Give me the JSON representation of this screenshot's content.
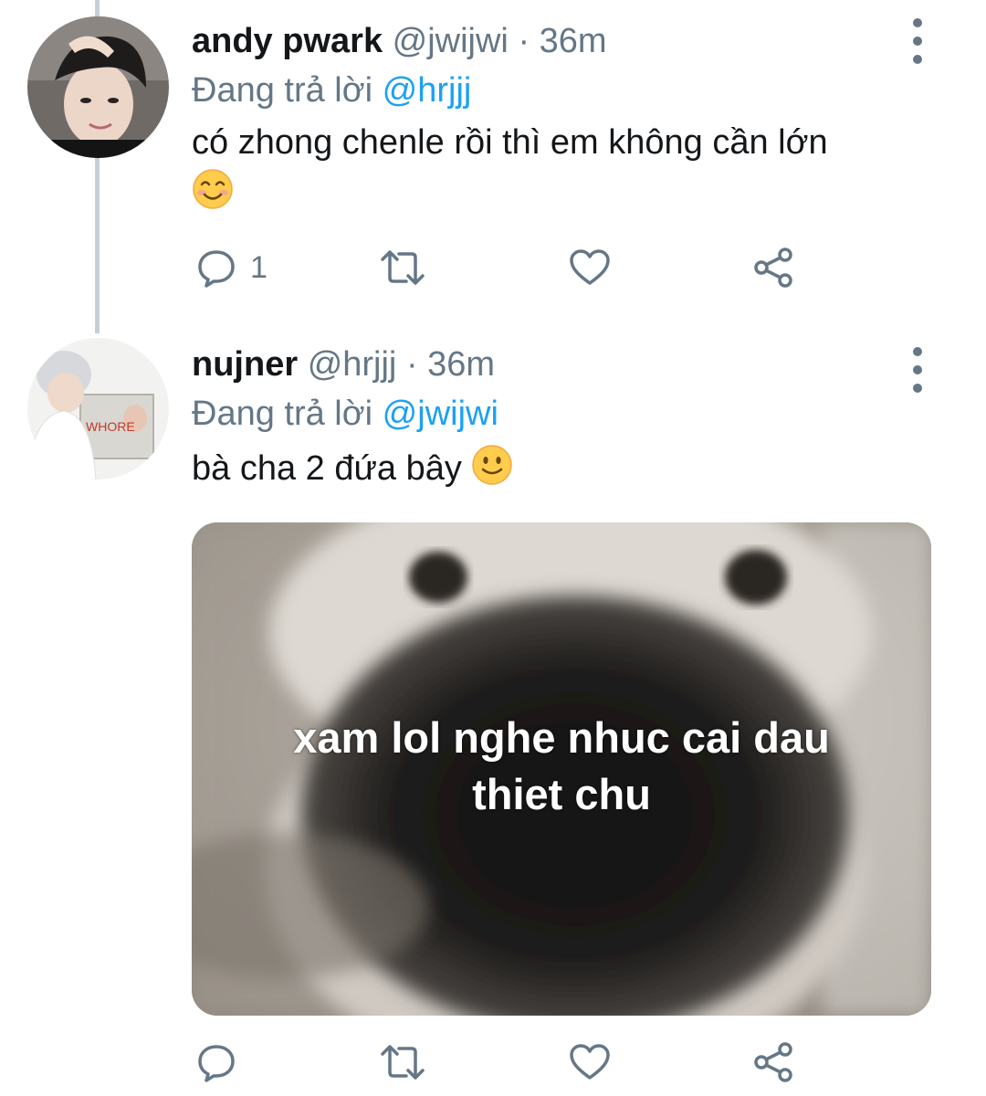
{
  "tweets": [
    {
      "display_name": "andy pwark",
      "handle": "@jwijwi",
      "time": "· 36m",
      "reply_prefix": "Đang trả lời",
      "reply_to": "@hrjjj",
      "text": "có zhong chenle rồi thì em không cần lớn",
      "emoji": "smiling-face-with-smiling-eyes",
      "reply_count": "1"
    },
    {
      "display_name": "nujner",
      "handle": "@hrjjj",
      "time": "· 36m",
      "reply_prefix": "Đang trả lời",
      "reply_to": "@jwijwi",
      "text": "bà cha 2 đứa bây",
      "emoji": "slightly-smiling-face",
      "avatar_mirror_text": "WHORE",
      "media_caption_line1": "xam lol nghe nhuc cai dau",
      "media_caption_line2": "thiet chu"
    }
  ],
  "icons": {
    "reply": "reply-icon",
    "retweet": "retweet-icon",
    "like": "heart-icon",
    "share": "share-icon",
    "more": "more-vertical-icon"
  },
  "colors": {
    "text": "#14171a",
    "secondary": "#657786",
    "mention": "#1da1f2",
    "thread_line": "#c4cfd6"
  }
}
